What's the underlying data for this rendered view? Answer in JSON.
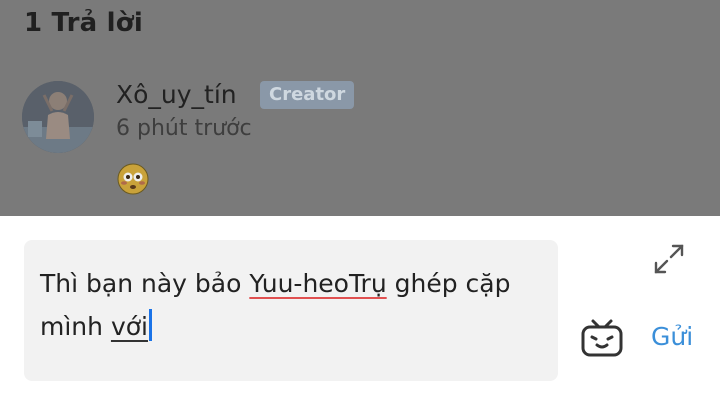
{
  "header": {
    "reply_count": "1 Trả lời"
  },
  "comment": {
    "username": "Xô_uy_tín",
    "badge": "Creator",
    "timestamp": "6 phút trước",
    "reaction_icon": "flushed-face-icon"
  },
  "composer": {
    "text_before": "Thì bạn này bảo ",
    "misspelled": "Yuu-heoTrụ",
    "text_middle": " ghép cặp mình ",
    "composing": "với",
    "send_label": "Gửi",
    "expand_icon": "expand-icon",
    "sticker_icon": "bilibili-tv-icon"
  },
  "colors": {
    "overlay_bg": "#7a7a7a",
    "badge_bg": "#8a98a8",
    "send": "#3b8fd9",
    "caret": "#1a73e8",
    "spellcheck": "#e05050"
  }
}
